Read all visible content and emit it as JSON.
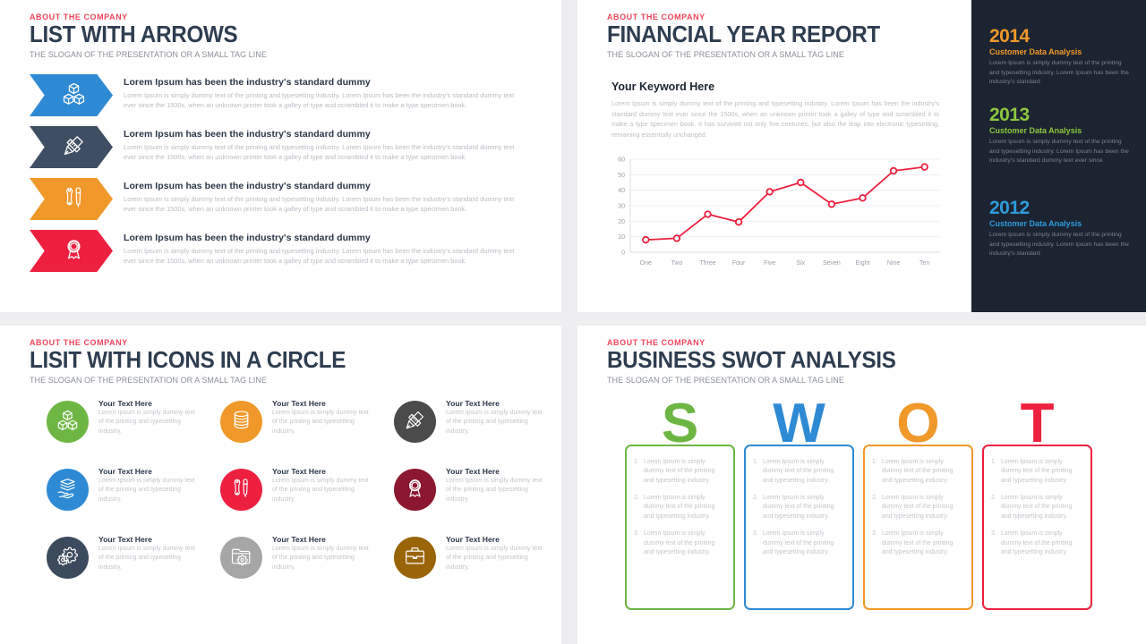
{
  "eyebrow": "ABOUT THE COMPANY",
  "slogan": "THE SLOGAN OF THE PRESENTATION OR A SMALL TAG LINE",
  "colors": {
    "accent_red": "#f0465c",
    "title_navy": "#2e3d50",
    "dark_rail_bg": "#1b2430",
    "blue": "#2e8ad4",
    "slate": "#3f4f63",
    "orange": "#f0982a",
    "red": "#ed2040"
  },
  "panel_list_arrows": {
    "title": "LIST WITH ARROWS",
    "items": [
      {
        "icon": "cubes-icon",
        "color": "#2e8ad4",
        "heading": "Lorem Ipsum has been the industry's standard dummy",
        "body": "Lorem Ipsum is simply dummy text of the printing and typesetting industry.  Lorem Ipsum has been the industry's  standard dummy text ever since the 1500s, when an unknown  printer took a galley of type and scrambled it to make a type specimen book."
      },
      {
        "icon": "pencil-ruler-icon",
        "color": "#3f4f63",
        "heading": "Lorem Ipsum has been the industry's standard dummy",
        "body": "Lorem Ipsum is simply dummy text of the printing and typesetting industry.  Lorem Ipsum has been the industry's  standard dummy text ever since the 1500s, when an unknown  printer took a galley of type and scrambled it to make a type specimen book."
      },
      {
        "icon": "wrench-screwdriver-icon",
        "color": "#f0982a",
        "heading": "Lorem Ipsum has been the industry's standard dummy",
        "body": "Lorem Ipsum is simply dummy text of the printing and typesetting industry.  Lorem Ipsum has been the industry's  standard dummy text ever since the 1500s, when an unknown  printer took a galley of type and scrambled it to make a type specimen book."
      },
      {
        "icon": "award-ribbon-icon",
        "color": "#ed2040",
        "heading": "Lorem Ipsum has been the industry's standard dummy",
        "body": "Lorem Ipsum is simply dummy text of the printing and typesetting industry.  Lorem Ipsum has been the industry's  standard dummy text ever since the 1500s, when an unknown  printer took a galley of type and scrambled it to make a type specimen book."
      }
    ]
  },
  "panel_financial": {
    "title": "FINANCIAL YEAR REPORT",
    "keyword_heading": "Your Keyword Here",
    "paragraph": "Lorem Ipsum is simply dummy text of the printing and typesetting industry.  Lorem Ipsum has been the industry's  standard dummy text ever since the 1500s, when an unknown  printer took a galley of type and scrambled it to make a type specimen book. It has survived not only five centuries,  but also the leap into electronic typesetting,  remaining essentially  unchanged."
  },
  "chart_data": {
    "type": "line",
    "title": "",
    "xlabel": "",
    "ylabel": "",
    "categories": [
      "One",
      "Two",
      "Three",
      "Four",
      "Five",
      "Six",
      "Seven",
      "Eight",
      "Nine",
      "Ten"
    ],
    "values": [
      8,
      9,
      24.5,
      19.5,
      39,
      45,
      31,
      35,
      52.5,
      55
    ],
    "ylim": [
      0,
      60
    ],
    "yticks": [
      0,
      10,
      20,
      30,
      40,
      50,
      60
    ],
    "grid": true,
    "legend": "none",
    "series_color": "#ed2040",
    "marker": "open-circle"
  },
  "dark_rail": {
    "blocks": [
      {
        "year": "2014",
        "year_color": "#f0982a",
        "subtitle": "Customer Data Analysis",
        "sub_color": "#f0982a",
        "body": "Lorem Ipsum is simply dummy text of the printing and typesetting industry.  Lorem Ipsum has been the industry's  standard"
      },
      {
        "year": "2013",
        "year_color": "#8dc63f",
        "subtitle": "Customer Data Analysis",
        "sub_color": "#8dc63f",
        "body": "Lorem Ipsum is simply dummy text of the printing and typesetting industry.  Lorem Ipsum has been the industry's  standard dummy text ever since"
      },
      {
        "year": "2012",
        "year_color": "#2e9bdc",
        "subtitle": "Customer Data Analysis",
        "sub_color": "#2e9bdc",
        "body": "Lorem Ipsum is simply dummy text of the printing and typesetting industry.  Lorem Ipsum has been the industry's  standard"
      }
    ]
  },
  "panel_icons_circle": {
    "title": "LISIT WITH ICONS IN A CIRCLE",
    "items": [
      {
        "icon": "cubes-icon",
        "color": "#6eb644",
        "heading": "Your Text Here",
        "body": "Lorem Ipsum is simply dummy text of the printing and typesetting industry."
      },
      {
        "icon": "database-coins-icon",
        "color": "#f0982a",
        "heading": "Your Text Here",
        "body": "Lorem Ipsum is simply dummy text of the printing and typesetting industry."
      },
      {
        "icon": "pencil-ruler-icon",
        "color": "#4b4b4b",
        "heading": "Your Text Here",
        "body": "Lorem Ipsum is simply dummy text of the printing and typesetting industry."
      },
      {
        "icon": "layers-hand-icon",
        "color": "#2e8ad4",
        "heading": "Your Text Here",
        "body": "Lorem Ipsum is simply dummy text of the printing and typesetting industry."
      },
      {
        "icon": "wrench-screwdriver-icon",
        "color": "#ed2040",
        "heading": "Your Text Here",
        "body": "Lorem Ipsum is simply dummy text of the printing and typesetting industry."
      },
      {
        "icon": "award-ribbon-icon",
        "color": "#8c1730",
        "heading": "Your Text Here",
        "body": "Lorem Ipsum is simply dummy text of the printing and typesetting industry."
      },
      {
        "icon": "gears-icon",
        "color": "#3b4a5c",
        "heading": "Your Text Here",
        "body": "Lorem Ipsum is simply dummy text of the printing and typesetting industry."
      },
      {
        "icon": "folder-gear-icon",
        "color": "#a6a6a6",
        "heading": "Your Text Here",
        "body": "Lorem Ipsum is simply dummy text of the printing and typesetting industry."
      },
      {
        "icon": "briefcase-icon",
        "color": "#9a6408",
        "heading": "Your Text Here",
        "body": "Lorem Ipsum is simply dummy text of the printing and typesetting industry."
      }
    ]
  },
  "panel_swot": {
    "title": "BUSINESS SWOT ANALYSIS",
    "columns": [
      {
        "letter": "S",
        "color": "#6eb644",
        "items": [
          {
            "num": "1.",
            "text": "Lorem Ipsum is simply dummy text of the printing and typesetting industry."
          },
          {
            "num": "2.",
            "text": "Lorem Ipsum is simply dummy text of the printing and typesetting industry."
          },
          {
            "num": "3.",
            "text": "Lorem Ipsum is simply dummy text of the printing and typesetting industry."
          }
        ]
      },
      {
        "letter": "W",
        "color": "#2e8ad4",
        "items": [
          {
            "num": "1.",
            "text": "Lorem Ipsum is simply dummy text of the printing and typesetting industry."
          },
          {
            "num": "2.",
            "text": "Lorem Ipsum is simply dummy text of the printing and typesetting industry."
          },
          {
            "num": "3.",
            "text": "Lorem Ipsum is simply dummy text of the printing and typesetting industry."
          }
        ]
      },
      {
        "letter": "O",
        "color": "#f0982a",
        "items": [
          {
            "num": "1.",
            "text": "Lorem Ipsum is simply dummy text of the printing and typesetting industry."
          },
          {
            "num": "2.",
            "text": "Lorem Ipsum is simply dummy text of the printing and typesetting industry."
          },
          {
            "num": "3.",
            "text": "Lorem Ipsum is simply dummy text of the printing and typesetting industry."
          }
        ]
      },
      {
        "letter": "T",
        "color": "#ed2040",
        "items": [
          {
            "num": "1.",
            "text": "Lorem Ipsum is simply dummy text of the printing and typesetting industry."
          },
          {
            "num": "2.",
            "text": "Lorem Ipsum is simply dummy text of the printing and typesetting industry."
          },
          {
            "num": "3.",
            "text": "Lorem Ipsum is simply dummy text of the printing and typesetting industry."
          }
        ]
      }
    ]
  }
}
